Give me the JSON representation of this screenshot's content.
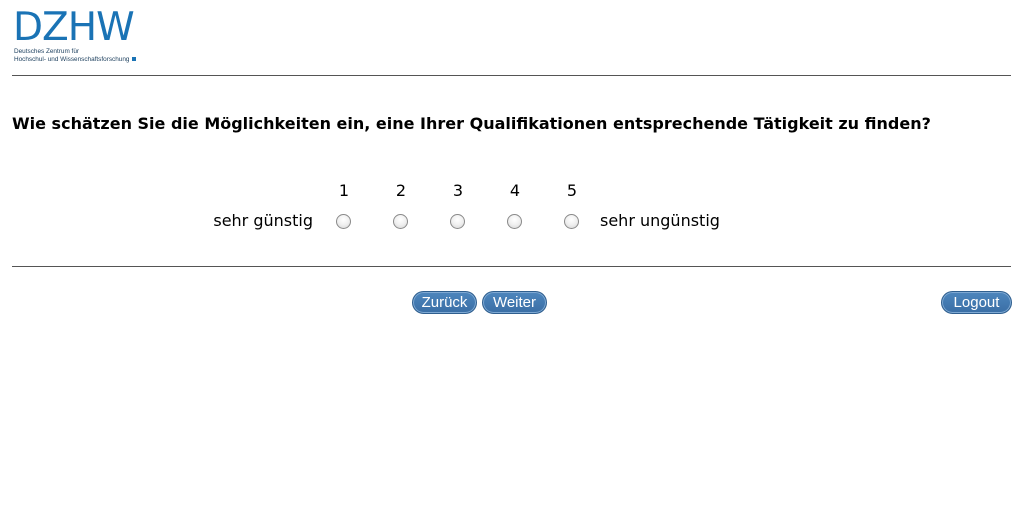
{
  "logo": {
    "wordmark": "DZHW",
    "line1": "Deutsches Zentrum für",
    "line2": "Hochschul- und Wissenschaftsforschung"
  },
  "question": {
    "text": "Wie schätzen Sie die Möglichkeiten ein, eine Ihrer Qualifikationen entsprechende Tätigkeit zu finden?"
  },
  "scale": {
    "left_anchor": "sehr günstig",
    "right_anchor": "sehr ungünstig",
    "options": [
      "1",
      "2",
      "3",
      "4",
      "5"
    ],
    "selected": null
  },
  "nav": {
    "back_label": "Zurück",
    "next_label": "Weiter",
    "logout_label": "Logout"
  },
  "colors": {
    "brand": "#1a73b5",
    "button": "#3a6ea5"
  }
}
